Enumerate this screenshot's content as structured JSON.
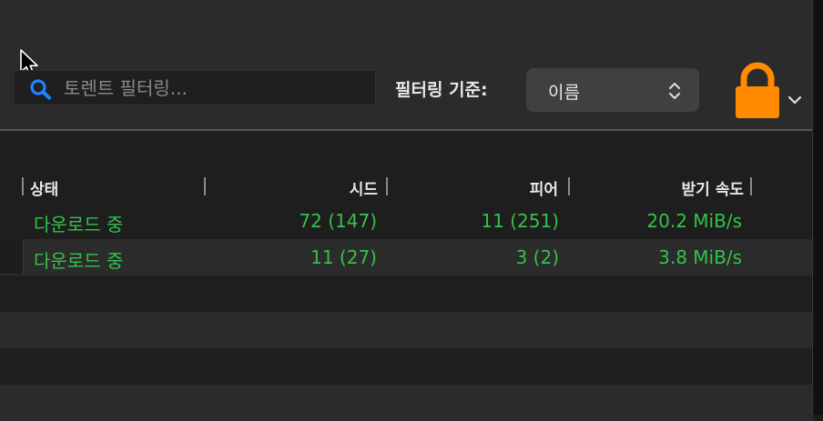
{
  "toolbar": {
    "search": {
      "placeholder": "토렌트 필터링...",
      "value": ""
    },
    "filter_label": "필터링 기준:",
    "filter_select": {
      "value": "이름"
    }
  },
  "table": {
    "columns": [
      {
        "key": "status",
        "label": "상태"
      },
      {
        "key": "seeds",
        "label": "시드"
      },
      {
        "key": "peers",
        "label": "피어"
      },
      {
        "key": "download_speed",
        "label": "받기 속도"
      }
    ],
    "rows": [
      {
        "status": "다운로드 중",
        "seeds": "72 (147)",
        "peers": "11 (251)",
        "download_speed": "20.2 MiB/s"
      },
      {
        "status": "다운로드 중",
        "seeds": "11 (27)",
        "peers": "3 (2)",
        "download_speed": "3.8 MiB/s"
      }
    ]
  },
  "colors": {
    "accent_green": "#34c24a",
    "lock_orange": "#ff8a00",
    "search_icon_blue": "#1a84ff",
    "background": "#1e1e1e",
    "toolbar": "#2b2b2b"
  },
  "icons": [
    "cursor-icon",
    "search-icon",
    "updown-icon",
    "lock-icon",
    "chevron-down-icon"
  ]
}
